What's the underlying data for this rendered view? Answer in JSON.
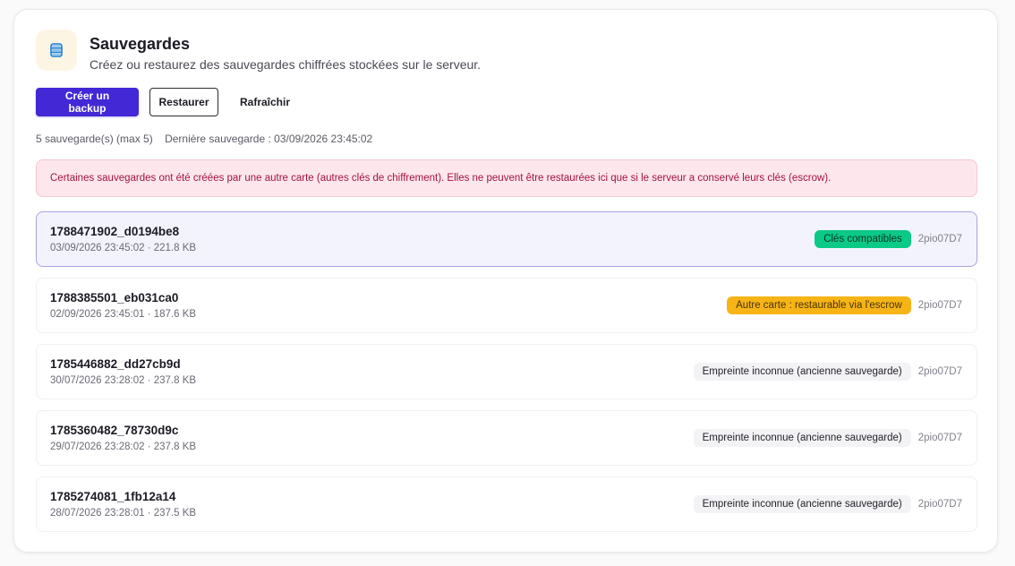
{
  "header": {
    "icon": "database-icon",
    "title": "Sauvegardes",
    "subtitle": "Créez ou restaurez des sauvegardes chiffrées stockées sur le serveur."
  },
  "toolbar": {
    "create_label": "Créer un backup",
    "restore_label": "Restaurer",
    "refresh_label": "Rafraîchir"
  },
  "meta": {
    "count": "5 sauvegarde(s) (max 5)",
    "last": "Dernière sauvegarde : 03/09/2026 23:45:02"
  },
  "alert": {
    "text": "Certaines sauvegardes ont été créées par une autre carte (autres clés de chiffrement). Elles ne peuvent être restaurées ici que si le serveur a conservé leurs clés (escrow)."
  },
  "colors": {
    "primary": "#4328d6",
    "alert_bg": "#fde7ec",
    "alert_text": "#a3123e",
    "badge_ok": "#0bc987",
    "badge_warn": "#f6b417",
    "badge_unknown": "#f3f3f5",
    "selected_bg": "#f3f3fd"
  },
  "backups": [
    {
      "name": "1788471902_d0194be8",
      "details": "03/09/2026 23:45:02 · 221.8 KB",
      "badge": "Clés compatibles",
      "badge_type": "ok",
      "device": "2pio07D7",
      "selected": true
    },
    {
      "name": "1788385501_eb031ca0",
      "details": "02/09/2026 23:45:01 · 187.6 KB",
      "badge": "Autre carte : restaurable via l'escrow",
      "badge_type": "warn",
      "device": "2pio07D7",
      "selected": false
    },
    {
      "name": "1785446882_dd27cb9d",
      "details": "30/07/2026 23:28:02 · 237.8 KB",
      "badge": "Empreinte inconnue (ancienne sauvegarde)",
      "badge_type": "unknown",
      "device": "2pio07D7",
      "selected": false
    },
    {
      "name": "1785360482_78730d9c",
      "details": "29/07/2026 23:28:02 · 237.8 KB",
      "badge": "Empreinte inconnue (ancienne sauvegarde)",
      "badge_type": "unknown",
      "device": "2pio07D7",
      "selected": false
    },
    {
      "name": "1785274081_1fb12a14",
      "details": "28/07/2026 23:28:01 · 237.5 KB",
      "badge": "Empreinte inconnue (ancienne sauvegarde)",
      "badge_type": "unknown",
      "device": "2pio07D7",
      "selected": false
    }
  ]
}
